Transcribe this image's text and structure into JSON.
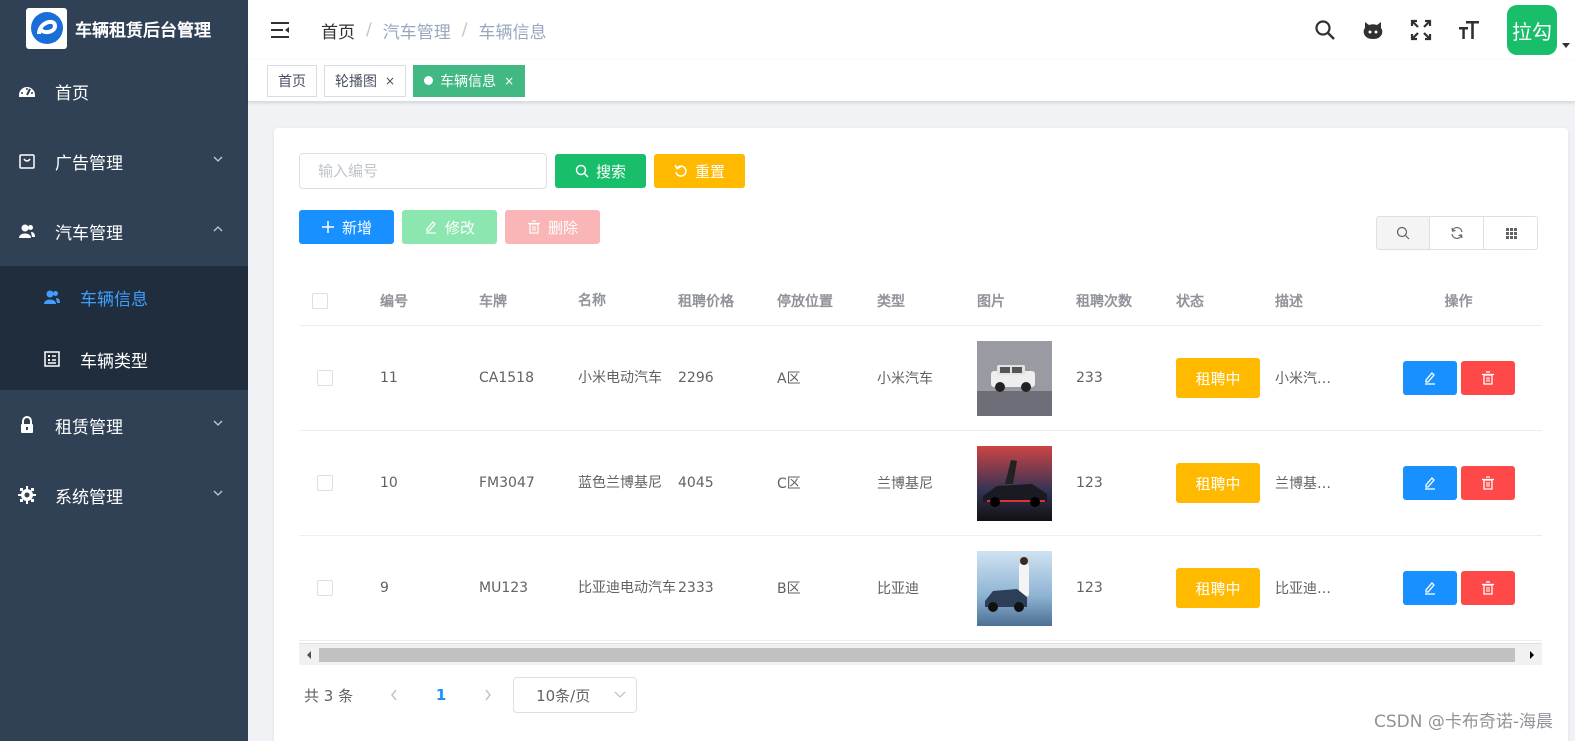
{
  "app": {
    "title": "车辆租赁后台管理"
  },
  "sidebar": {
    "items": [
      {
        "label": "首页",
        "icon": "dashboard-icon"
      },
      {
        "label": "广告管理",
        "icon": "shopping-bag-icon"
      },
      {
        "label": "汽车管理",
        "icon": "peoples-icon"
      },
      {
        "label": "租赁管理",
        "icon": "lock-icon"
      },
      {
        "label": "系统管理",
        "icon": "gear-icon"
      }
    ],
    "sub_items": [
      {
        "label": "车辆信息",
        "icon": "user-icon"
      },
      {
        "label": "车辆类型",
        "icon": "form-icon"
      }
    ]
  },
  "header": {
    "breadcrumb": [
      "首页",
      "汽车管理",
      "车辆信息"
    ],
    "avatar_text": "拉勾"
  },
  "tags": [
    {
      "label": "首页"
    },
    {
      "label": "轮播图",
      "close": "×"
    },
    {
      "label": "车辆信息",
      "close": "×"
    }
  ],
  "search": {
    "placeholder": "输入编号",
    "search_label": "搜索",
    "reset_label": "重置"
  },
  "actions": {
    "add_label": "新增",
    "edit_label": "修改",
    "delete_label": "删除"
  },
  "table": {
    "columns": [
      "编号",
      "车牌",
      "名称",
      "租聘价格",
      "停放位置",
      "类型",
      "图片",
      "租聘次数",
      "状态",
      "描述",
      "操作"
    ],
    "rows": [
      {
        "id": "11",
        "plate": "CA1518",
        "name": "小米电动汽车",
        "price": "2296",
        "location": "A区",
        "type": "小米汽车",
        "count": "233",
        "status": "租聘中",
        "desc": "小米汽…"
      },
      {
        "id": "10",
        "plate": "FM3047",
        "name": "蓝色兰博基尼",
        "price": "4045",
        "location": "C区",
        "type": "兰博基尼",
        "count": "123",
        "status": "租聘中",
        "desc": "兰博基…"
      },
      {
        "id": "9",
        "plate": "MU123",
        "name": "比亚迪电动汽车",
        "price": "2333",
        "location": "B区",
        "type": "比亚迪",
        "count": "123",
        "status": "租聘中",
        "desc": "比亚迪…"
      }
    ]
  },
  "pagination": {
    "total": "共 3 条",
    "current": "1",
    "page_size": "10条/页"
  },
  "watermark": "CSDN @卡布奇诺-海晨",
  "colors": {
    "sidebar_bg": "#304156",
    "primary": "#1890ff",
    "success": "#19be6b",
    "warning": "#ffba00",
    "danger": "#ff4949",
    "tag_active": "#42b983"
  }
}
